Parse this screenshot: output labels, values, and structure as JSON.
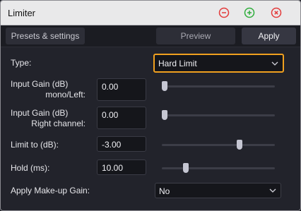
{
  "window": {
    "title": "Limiter"
  },
  "titlebar_buttons": [
    {
      "icon": "minimize-icon",
      "color": "#e33a3a"
    },
    {
      "icon": "maximize-icon",
      "color": "#2fae3c"
    },
    {
      "icon": "close-icon",
      "color": "#e33a3a"
    }
  ],
  "toolbar": {
    "presets_label": "Presets & settings",
    "preview_label": "Preview",
    "apply_label": "Apply"
  },
  "form": {
    "type": {
      "label": "Type:",
      "value": "Hard Limit"
    },
    "input_gain_left": {
      "label_line1": "Input Gain (dB)",
      "label_line2": "mono/Left:",
      "value": "0.00",
      "slider": 0.0
    },
    "input_gain_right": {
      "label_line1": "Input Gain (dB)",
      "label_line2": "Right channel:",
      "value": "0.00",
      "slider": 0.0
    },
    "limit_to": {
      "label": "Limit to (dB):",
      "value": "-3.00",
      "slider": 0.7
    },
    "hold": {
      "label": "Hold (ms):",
      "value": "10.00",
      "slider": 0.2
    },
    "makeup_gain": {
      "label": "Apply Make-up Gain:",
      "value": "No"
    }
  },
  "colors": {
    "accent": "#f0a01f",
    "background": "#22232b"
  }
}
